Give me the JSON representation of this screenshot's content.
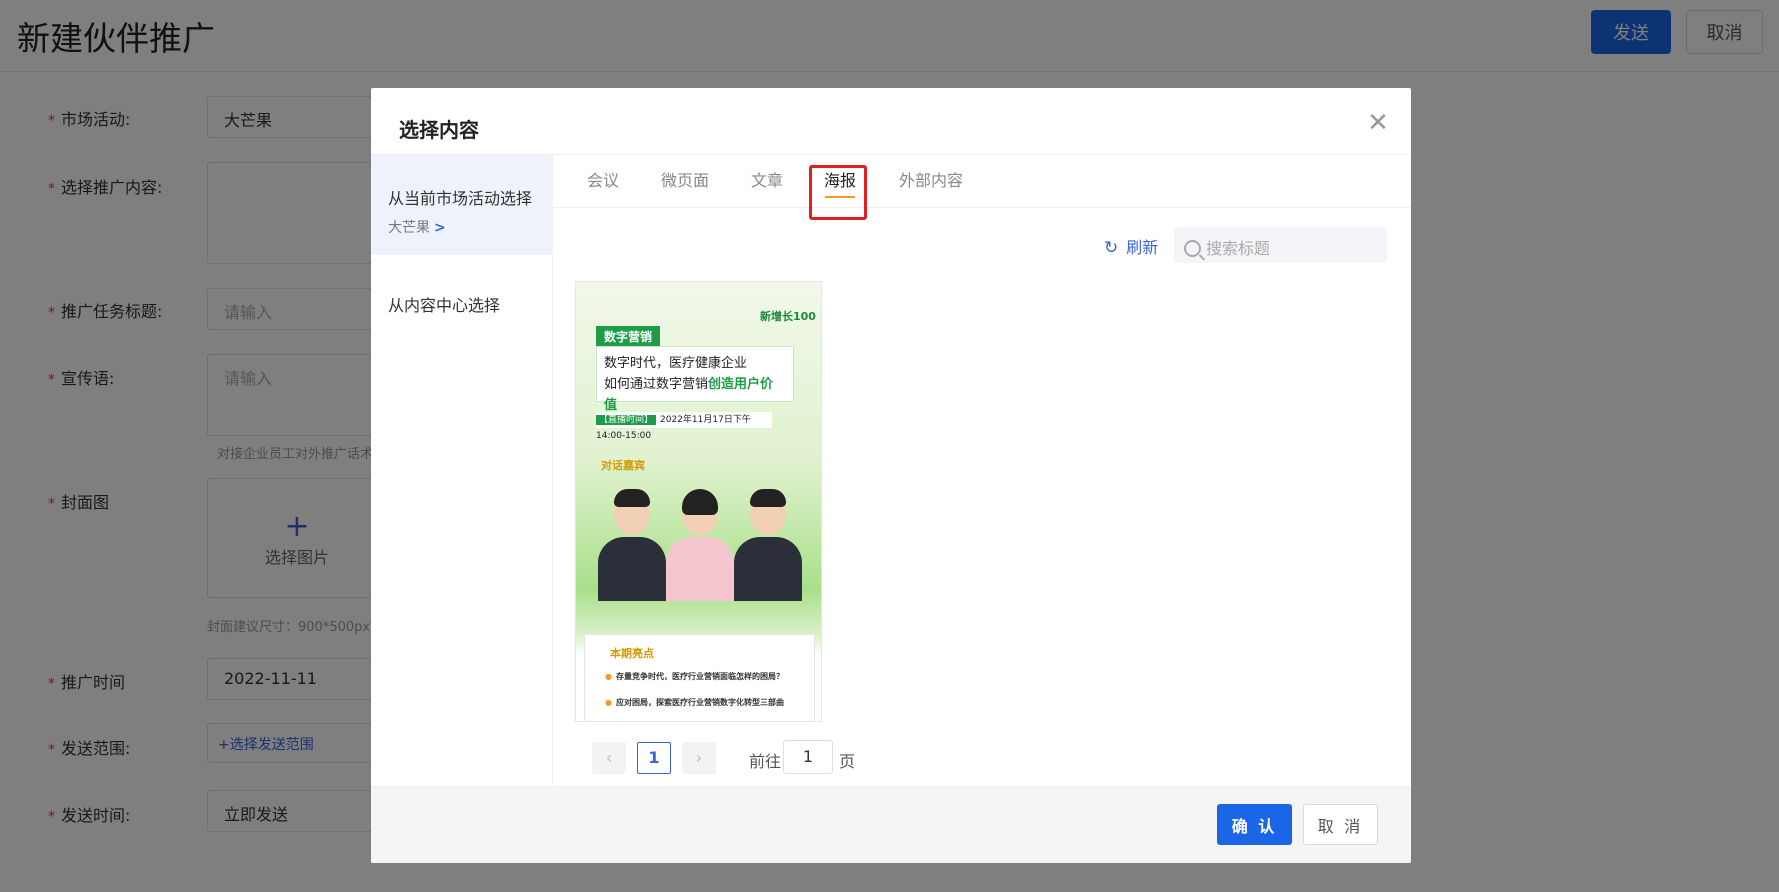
{
  "page": {
    "title": "新建伙伴推广",
    "send_label": "发送",
    "cancel_label": "取消"
  },
  "form": {
    "activity_label": "市场活动:",
    "activity_value": "大芒果",
    "content_label": "选择推广内容:",
    "task_title_label": "推广任务标题:",
    "task_title_placeholder": "请输入",
    "slogan_label": "宣传语:",
    "slogan_placeholder": "请输入",
    "slogan_hint": "对接企业员工对外推广话术",
    "cover_label": "封面图",
    "cover_upload_label": "选择图片",
    "cover_hint": "封面建议尺寸：900*500px",
    "time_label": "推广时间",
    "time_value": "2022-11-11",
    "scope_label": "发送范围:",
    "scope_link": "+选择发送范围",
    "send_time_label": "发送时间:",
    "send_time_value": "立即发送"
  },
  "modal": {
    "title": "选择内容",
    "close_icon": "close-icon",
    "sidebar": [
      {
        "label": "从当前市场活动选择",
        "sub": "大芒果"
      },
      {
        "label": "从内容中心选择"
      }
    ],
    "tabs": [
      "会议",
      "微页面",
      "文章",
      "海报",
      "外部内容"
    ],
    "active_tab": "海报",
    "refresh_label": "刷新",
    "search_placeholder": "搜索标题",
    "poster": {
      "brand": "新增长100",
      "tag": "数字营销",
      "headline_line1": "数字时代，医疗健康企业",
      "headline_line2_prefix": "如何通过数字营销",
      "headline_line2_highlight": "创造用户价值",
      "time_tag": "【直播时间】",
      "time_text": "2022年11月17日下午14:00-15:00",
      "guests_title": "对话嘉宾",
      "highlights_title": "本期亮点",
      "bullet1": "存量竞争时代，医疗行业营销面临怎样的困局？",
      "bullet2": "应对困局，探索医疗行业营销数字化转型三部曲"
    },
    "pagination": {
      "current": "1",
      "goto_label": "前往",
      "goto_value": "1",
      "page_unit": "页"
    },
    "confirm_label": "确 认",
    "cancel_label": "取 消"
  },
  "colors": {
    "primary": "#1a66e6",
    "highlight_border": "#e02020",
    "tab_underline": "#f59a23",
    "required_star": "#e53935"
  }
}
